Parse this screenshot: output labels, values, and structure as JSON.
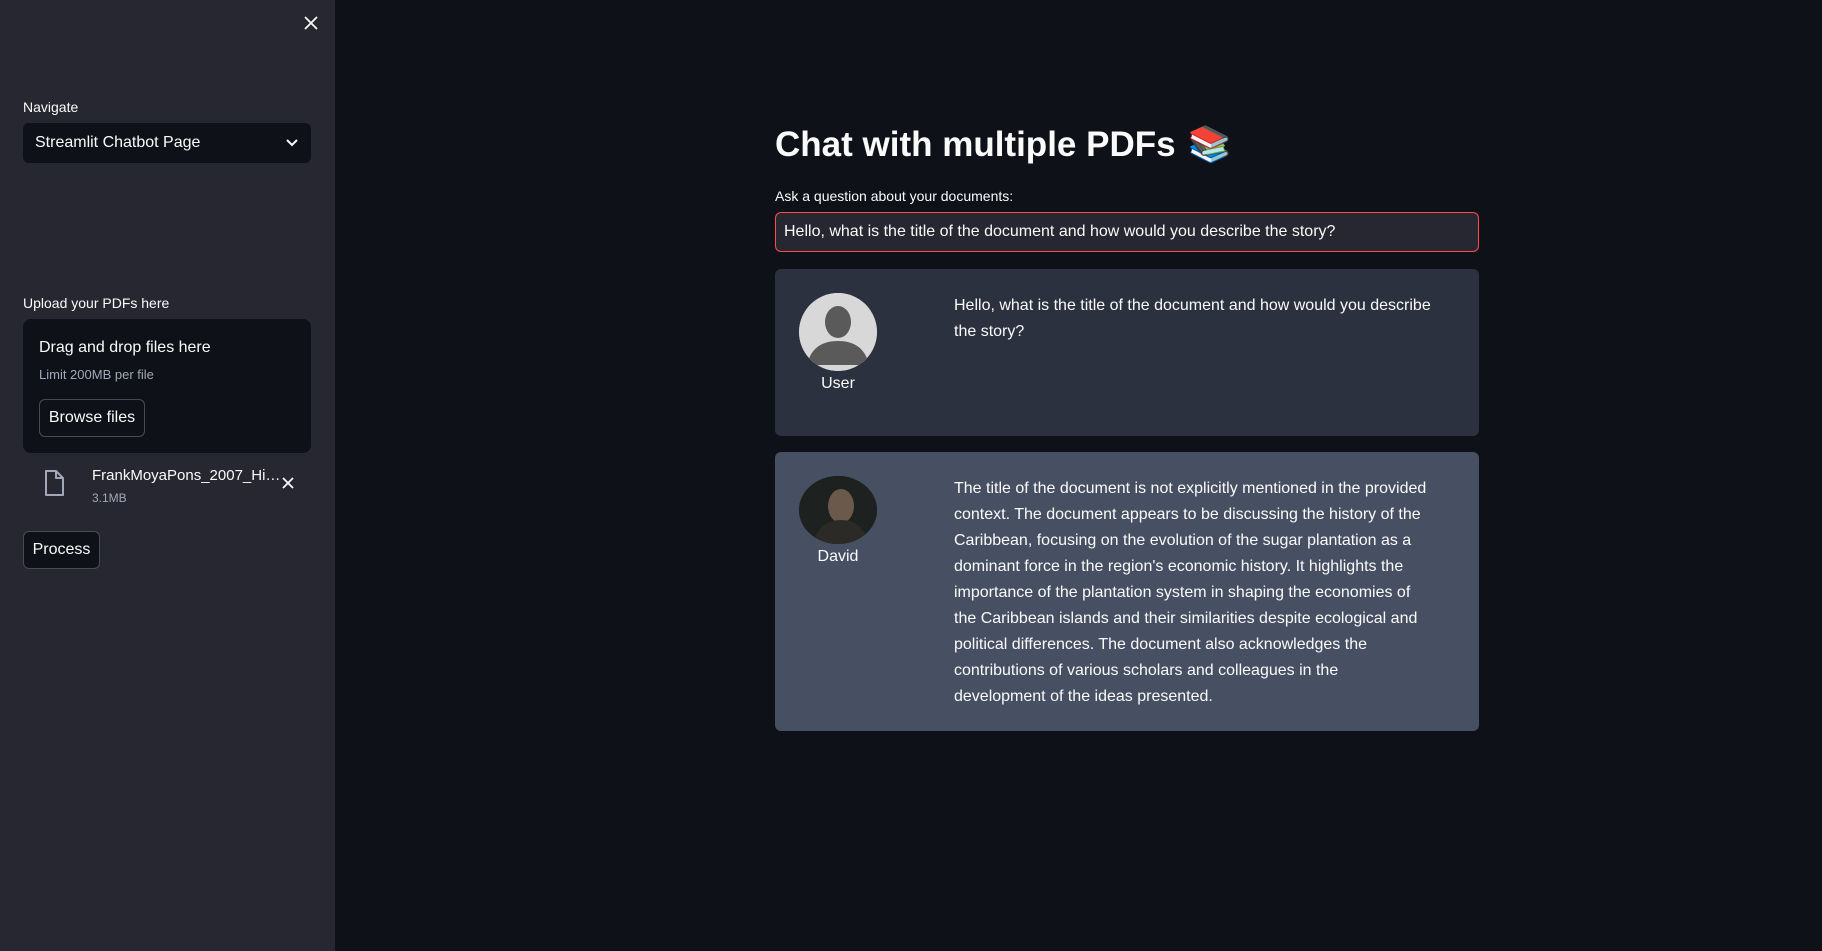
{
  "sidebar": {
    "navigate_label": "Navigate",
    "navigate_value": "Streamlit Chatbot Page",
    "upload_label": "Upload your PDFs here",
    "dropzone_title": "Drag and drop files here",
    "dropzone_limit": "Limit 200MB per file",
    "browse_label": "Browse files",
    "file": {
      "name": "FrankMoyaPons_2007_Hi…",
      "size": "3.1MB"
    },
    "process_label": "Process"
  },
  "main": {
    "title": "Chat with multiple PDFs",
    "title_emoji": "📚",
    "question_label": "Ask a question about your documents:",
    "question_value": "Hello, what is the title of the document and how would you describe the story?"
  },
  "messages": [
    {
      "author": "User",
      "text": "Hello, what is the title of the document and how would you describe the story?"
    },
    {
      "author": "David",
      "text": "The title of the document is not explicitly mentioned in the provided context. The document appears to be discussing the history of the Caribbean, focusing on the evolution of the sugar plantation as a dominant force in the region's economic history. It highlights the importance of the plantation system in shaping the economies of the Caribbean islands and their similarities despite ecological and political differences. The document also acknowledges the contributions of various scholars and colleagues in the development of the ideas presented."
    }
  ],
  "colors": {
    "background": "#0e1117",
    "sidebar": "#262730",
    "user_message": "#2b313e",
    "bot_message": "#475063",
    "focus_border": "#ff4b4b"
  }
}
